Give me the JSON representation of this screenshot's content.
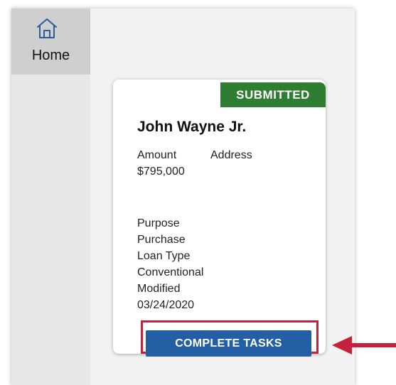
{
  "colors": {
    "sidebar_active": "#cfcfcf",
    "home_icon": "#2b5c9c",
    "badge_bg": "#2e7d32",
    "button_bg": "#245fa5",
    "highlight": "#c4213a"
  },
  "sidebar": {
    "items": [
      {
        "label": "Home",
        "icon": "home-icon",
        "active": true
      }
    ]
  },
  "card": {
    "status": "SUBMITTED",
    "borrower_name": "John Wayne Jr.",
    "fields": {
      "amount_label": "Amount",
      "amount_value": "$795,000",
      "address_label": "Address",
      "purpose_label": "Purpose",
      "purpose_value": "Purchase",
      "loan_type_label": "Loan Type",
      "loan_type_value": "Conventional",
      "modified_label": "Modified",
      "modified_value": "03/24/2020"
    },
    "action_label": "COMPLETE TASKS"
  },
  "annotation": {
    "highlight": "red box around action button",
    "pointer": "arrow-left-icon"
  }
}
